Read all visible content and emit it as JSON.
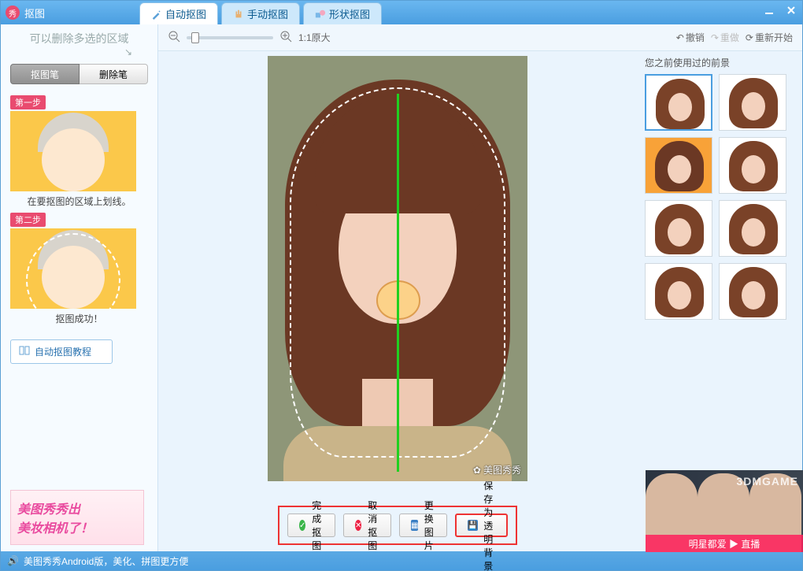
{
  "window": {
    "title": "抠图"
  },
  "tabs": [
    {
      "label": "自动抠图",
      "active": true
    },
    {
      "label": "手动抠图",
      "active": false
    },
    {
      "label": "形状抠图",
      "active": false
    }
  ],
  "sidebar": {
    "hint": "可以删除多选的区域",
    "tools": {
      "draw": "抠图笔",
      "erase": "删除笔"
    },
    "step1_tag": "第一步",
    "step1_caption": "在要抠图的区域上划线。",
    "step2_tag": "第二步",
    "step2_caption": "抠图成功！",
    "tutorial": "自动抠图教程",
    "promo_l1": "美图秀秀出",
    "promo_l2": "美妆相机了！"
  },
  "toolbar": {
    "zoom_label": "1:1原大",
    "undo": "撤销",
    "redo": "重做",
    "restart": "重新开始"
  },
  "canvas": {
    "watermark": "美图秀秀"
  },
  "actions": {
    "finish": "完成抠图",
    "cancel": "取消抠图",
    "change": "更换图片",
    "save_transparent": "保存为透明背景"
  },
  "right": {
    "title": "您之前使用过的前景",
    "thumbs": [
      {
        "selected": true,
        "bg": "white"
      },
      {
        "selected": false,
        "bg": "white"
      },
      {
        "selected": false,
        "bg": "orange"
      },
      {
        "selected": false,
        "bg": "white"
      },
      {
        "selected": false,
        "bg": "white"
      },
      {
        "selected": false,
        "bg": "white"
      },
      {
        "selected": false,
        "bg": "white"
      },
      {
        "selected": false,
        "bg": "white"
      }
    ]
  },
  "ad": {
    "strip": "明星都爱 ▶ 直播",
    "corner": "3DMGAME"
  },
  "status": {
    "text": "美图秀秀Android版，美化、拼图更方便"
  }
}
